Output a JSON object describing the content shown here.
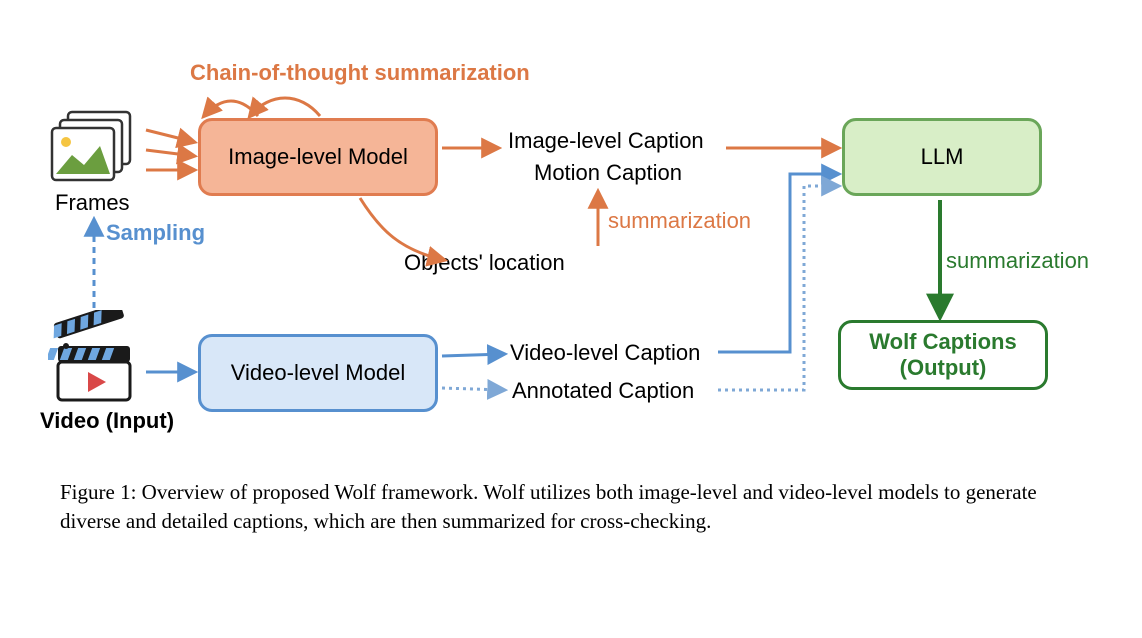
{
  "diagram": {
    "top_annotation": "Chain-of-thought summarization",
    "frames_label": "Frames",
    "sampling_label": "Sampling",
    "video_input_label": "Video (Input)",
    "image_model": "Image-level Model",
    "video_model": "Video-level Model",
    "objects_location": "Objects' location",
    "image_caption": "Image-level Caption",
    "motion_caption": "Motion Caption",
    "summarization_up": "summarization",
    "video_caption": "Video-level Caption",
    "annotated_caption": "Annotated Caption",
    "llm": "LLM",
    "summarization_right": "summarization",
    "output_line1": "Wolf Captions",
    "output_line2": "(Output)"
  },
  "figure_caption": "Figure 1: Overview of proposed Wolf framework. Wolf utilizes both image-level and video-level models to generate diverse and detailed captions, which are then summarized for cross-checking."
}
